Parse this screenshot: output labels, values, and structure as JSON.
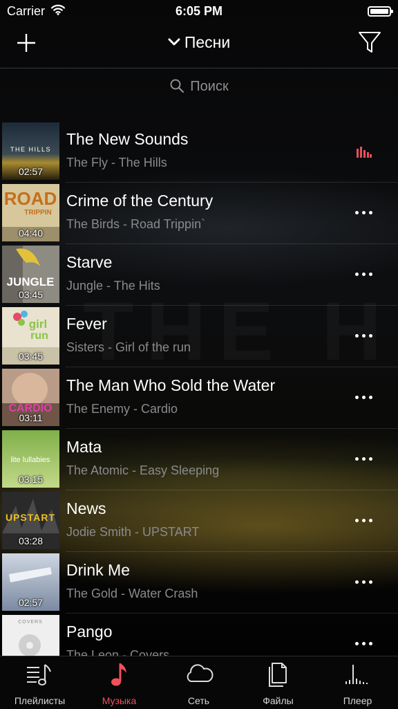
{
  "status_bar": {
    "carrier": "Carrier",
    "time": "6:05 PM"
  },
  "nav": {
    "title": "Песни",
    "add_icon": "plus-icon",
    "filter_icon": "filter-icon"
  },
  "search": {
    "placeholder": "Поиск"
  },
  "songs": [
    {
      "title": "The New Sounds",
      "subtitle": "The Fly - The Hills",
      "duration": "02:57",
      "state": "playing"
    },
    {
      "title": "Crime of the Century",
      "subtitle": "The Birds - Road Trippin`",
      "duration": "04:40",
      "state": "more"
    },
    {
      "title": "Starve",
      "subtitle": "Jungle - The Hits",
      "duration": "03:45",
      "state": "more"
    },
    {
      "title": "Fever",
      "subtitle": "Sisters - Girl of the run",
      "duration": "03:45",
      "state": "more"
    },
    {
      "title": "The Man Who Sold the Water",
      "subtitle": "The Enemy - Cardio",
      "duration": "03:11",
      "state": "more"
    },
    {
      "title": "Mata",
      "subtitle": "The Atomic - Easy Sleeping",
      "duration": "03:15",
      "state": "more"
    },
    {
      "title": "News",
      "subtitle": "Jodie Smith - UPSTART",
      "duration": "03:28",
      "state": "more"
    },
    {
      "title": "Drink Me",
      "subtitle": "The Gold - Water Crash",
      "duration": "02:57",
      "state": "more"
    },
    {
      "title": "Pango",
      "subtitle": "The Leon - Covers",
      "duration": "",
      "state": "more"
    }
  ],
  "album_art_text": [
    "THE HILLS",
    "ROAD",
    "TRIPPIN",
    "JUNGLE",
    "girl",
    "run",
    "CARDIO",
    "lite lullabies",
    "UPSTART",
    "COVERS"
  ],
  "tabs": [
    {
      "label": "Плейлисты",
      "icon": "playlist-icon"
    },
    {
      "label": "Музыка",
      "icon": "music-note-icon",
      "active": true
    },
    {
      "label": "Сеть",
      "icon": "cloud-icon"
    },
    {
      "label": "Файлы",
      "icon": "files-icon"
    },
    {
      "label": "Плеер",
      "icon": "player-icon"
    }
  ],
  "colors": {
    "accent": "#f0505a",
    "playing_indicator": "#e8505b",
    "background": "#000000"
  }
}
